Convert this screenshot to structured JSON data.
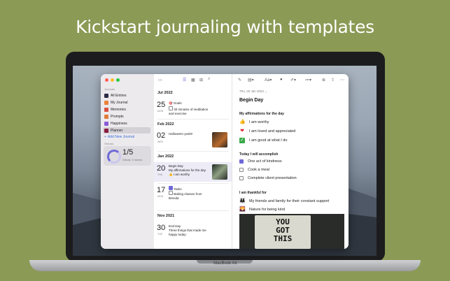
{
  "headline": "Kickstart journaling with templates",
  "device_label": "MacBook Air",
  "sidebar": {
    "journals_header": "Journals",
    "journals": [
      {
        "label": "All Entries",
        "color": "#2a2a44"
      },
      {
        "label": "My Journal",
        "color": "#e9833a"
      },
      {
        "label": "Memories",
        "color": "#d9503e"
      },
      {
        "label": "Prompts",
        "color": "#e07b3a"
      },
      {
        "label": "Happiness",
        "color": "#8a5bd6"
      },
      {
        "label": "Planner",
        "color": "#8a1e3f"
      }
    ],
    "add_label": "Add New Journal",
    "streaks_header": "Streaks",
    "streak_value": "1/5",
    "streak_label": "Streak: 0 weeks"
  },
  "list": {
    "groups": [
      {
        "month": "Jul 2022",
        "entries": [
          {
            "day": "25",
            "weekday": "MON",
            "title": "Goals",
            "lines": "30 minutes of meditation and exercise"
          }
        ]
      },
      {
        "month": "Feb 2022",
        "entries": [
          {
            "day": "02",
            "weekday": "WED",
            "title": "Halloween yeah!!",
            "lines": ""
          }
        ]
      },
      {
        "month": "Jan 2022",
        "entries": [
          {
            "day": "20",
            "weekday": "THU",
            "title": "Begin Day",
            "lines": "My affirmations for the day",
            "line2": "I am worthy"
          },
          {
            "day": "17",
            "weekday": "MON",
            "title": "Tasks",
            "lines": "Baking classes from Brenda"
          }
        ]
      },
      {
        "month": "Nov 2021",
        "entries": [
          {
            "day": "30",
            "weekday": "TUE",
            "title": "End Day",
            "lines": "Three things that made me happy today:"
          }
        ]
      }
    ]
  },
  "editor": {
    "date": "Thu, 20 Jan 2022",
    "title": "Begin Day",
    "sections": [
      {
        "heading": "My affirmations for the day",
        "items": [
          "I am worthy",
          "I am loved and appreciated",
          "I am good at what I do"
        ]
      },
      {
        "heading": "Today I will accomplish",
        "items": [
          "One act of kindness",
          "Cook a meal",
          "Complete client presentation"
        ]
      },
      {
        "heading": "I am thankful for",
        "items": [
          "My friends and family for their constant support",
          "Nature for being kind"
        ]
      }
    ],
    "photo_sign": [
      "YOU",
      "GOT",
      "THIS"
    ]
  }
}
